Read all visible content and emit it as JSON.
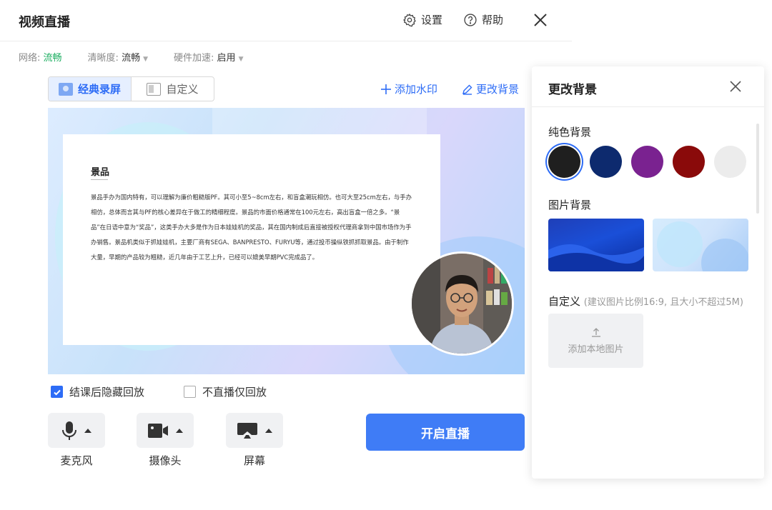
{
  "header": {
    "title": "视频直播",
    "settings_label": "设置",
    "help_label": "帮助"
  },
  "settings": {
    "network_label": "网络:",
    "network_value": "流畅",
    "clarity_label": "清晰度:",
    "clarity_value": "流畅",
    "hw_label": "硬件加速:",
    "hw_value": "启用"
  },
  "tabs": [
    {
      "label": "经典录屏",
      "active": true
    },
    {
      "label": "自定义",
      "active": false
    }
  ],
  "actions": {
    "add_watermark": "添加水印",
    "change_background": "更改背景"
  },
  "preview": {
    "doc_title": "景品",
    "doc_body": "景品手办为国内特有，可以理解为廉价粗糙版PF。其可小至5~8cm左右，和盲盒潮玩相仿。也可大至25cm左右，与手办相仿，总体而言其与PF的核心差异在于做工的精细程度。景品的市面价格通常在100元左右，高出盲盒一倍之多。“景品”在日语中意为“奖品”，这类手办大多是作为日本娃娃机的奖品，其在国内制成后直接被授权代理商拿到中国市场作为手办销售。景品机类似于抓娃娃机，主要厂商有SEGA、BANPRESTO、FURYU等，通过投币操纵铁抓抓取景品。由于制作大量，早期的产品较为粗糙，近几年由于工艺上升，已经可以媲美早期PVC完成品了。"
  },
  "options": {
    "hide_replay": {
      "label": "结课后隐藏回放",
      "checked": true
    },
    "no_live_replay": {
      "label": "不直播仅回放",
      "checked": false
    }
  },
  "devices": {
    "mic": "麦克风",
    "camera": "摄像头",
    "screen": "屏幕"
  },
  "start_button": "开启直播",
  "panel": {
    "title": "更改背景",
    "solid_label": "纯色背景",
    "image_label": "图片背景",
    "custom_label": "自定义",
    "custom_hint": "(建议图片比例16:9, 且大小不超过5M)",
    "upload_label": "添加本地图片",
    "colors": [
      "#1f1f1f",
      "#0d2a6e",
      "#7a2290",
      "#8a0a0a",
      "#ececec"
    ]
  },
  "colors": {
    "accent": "#2d6cf6",
    "network_ok": "#1aad5f",
    "start_bg": "#3f7cf6"
  }
}
